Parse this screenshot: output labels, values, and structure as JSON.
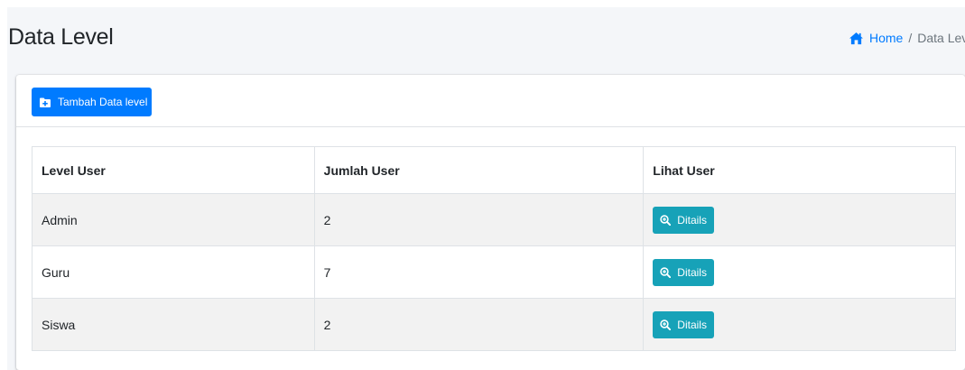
{
  "header": {
    "title": "Data Level",
    "breadcrumb": {
      "home_label": "Home",
      "separator": "/",
      "current": "Data Lev"
    }
  },
  "toolbar": {
    "add_label": "Tambah Data level"
  },
  "table": {
    "columns": [
      "Level User",
      "Jumlah User",
      "Lihat User"
    ],
    "rows": [
      {
        "level": "Admin",
        "jumlah": "2",
        "action": "Ditails"
      },
      {
        "level": "Guru",
        "jumlah": "7",
        "action": "Ditails"
      },
      {
        "level": "Siswa",
        "jumlah": "2",
        "action": "Ditails"
      }
    ]
  },
  "colors": {
    "primary": "#007bff",
    "info": "#17a2b8",
    "background": "#f4f6f9"
  },
  "icons": {
    "home": "home-icon",
    "add": "folder-plus-icon",
    "detail": "search-plus-icon"
  }
}
